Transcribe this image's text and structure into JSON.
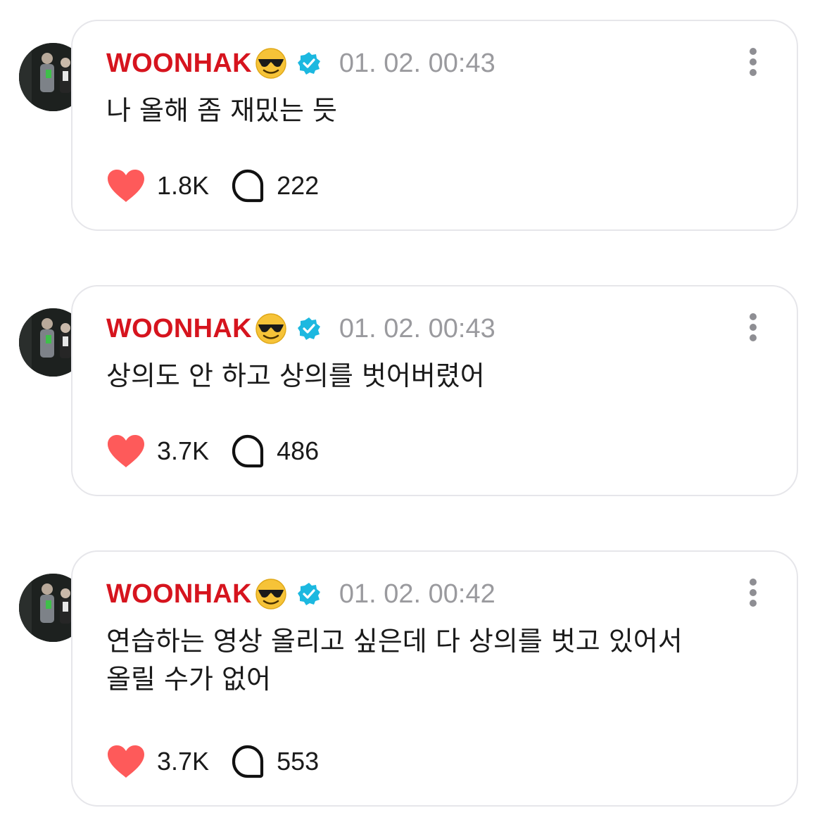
{
  "colors": {
    "username": "#d6141e",
    "timestamp": "#9a9a9e",
    "heart": "#fe5a5a",
    "verified": "#1cb8e0",
    "card_border": "#e6e6ea"
  },
  "icons": {
    "emoji": "sunglasses-emoji-icon",
    "verified": "verified-badge-icon",
    "more": "more-vertical-icon",
    "like": "heart-icon",
    "comment": "comment-bubble-icon"
  },
  "posts": [
    {
      "username": "WOONHAK",
      "timestamp": "01. 02. 00:43",
      "text": "나 올해 좀 재밌는 듯",
      "likes": "1.8K",
      "comments": "222"
    },
    {
      "username": "WOONHAK",
      "timestamp": "01. 02. 00:43",
      "text": "상의도 안 하고 상의를 벗어버렸어",
      "likes": "3.7K",
      "comments": "486"
    },
    {
      "username": "WOONHAK",
      "timestamp": "01. 02. 00:42",
      "text": "연습하는 영상 올리고 싶은데 다 상의를 벗고 있어서\n올릴 수가 없어",
      "likes": "3.7K",
      "comments": "553"
    }
  ]
}
